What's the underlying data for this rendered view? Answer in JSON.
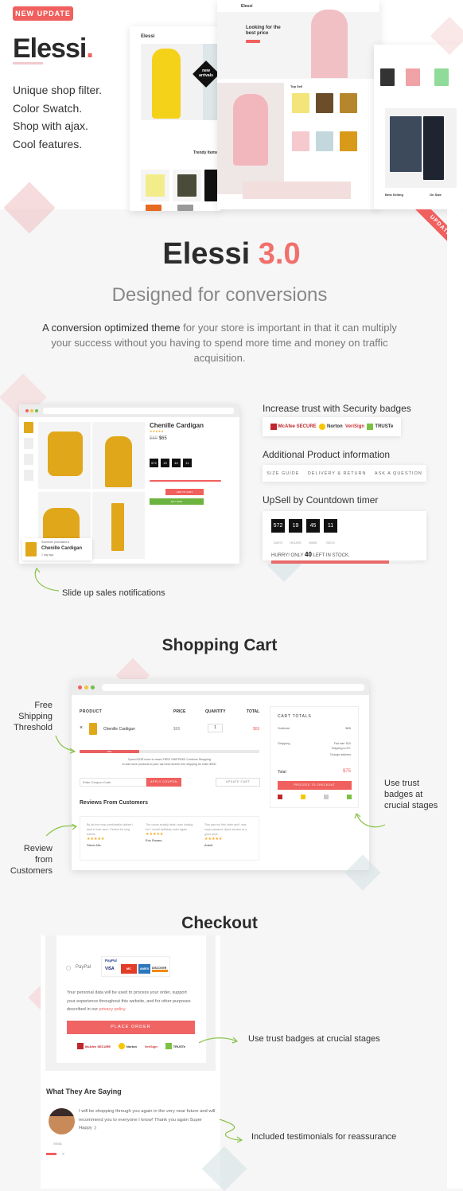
{
  "hero": {
    "badge": "NEW UPDATE",
    "logo": "Elessi",
    "logo_dot": ".",
    "features": [
      "Unique shop filter.",
      "Color Swatch.",
      "Shop with ajax.",
      "Cool features."
    ],
    "corner_ribbon": "UPDATE",
    "mock_texts": {
      "brand": "Elessi",
      "new_arrivals": "new arrivals",
      "trendy": "Trendy Items",
      "looking": "Looking for the best price",
      "top_sell": "Top Sell",
      "best_selling": "Best Selling",
      "on_sale": "On Sale"
    }
  },
  "intro": {
    "title": "Elessi",
    "version": "3.0",
    "subtitle": "Designed for conversions",
    "lead": "A conversion optimized theme",
    "body1": " for your store is important in that it can multiply your success without you having to spend more time and money on traffic acquisition."
  },
  "product": {
    "name": "Chenille Cardigan",
    "old_price": "$80",
    "price": "$65",
    "countdown": [
      "572",
      "19",
      "45",
      "11"
    ],
    "add_to_cart": "ADD TO CART",
    "buy_now": "BUY NOW",
    "notification": {
      "line": "Someone purchased a",
      "product": "Chenille Cardigan",
      "time": "1 day ago"
    }
  },
  "features": {
    "security": "Increase trust with Security badges",
    "badges": [
      "McAfee SECURE",
      "Norton",
      "VeriSign",
      "TRUSTe"
    ],
    "additional": "Additional Product information",
    "tabs": [
      "SIZE GUIDE",
      "DELIVERY & RETURN",
      "ASK A QUESTION"
    ],
    "upsell": "UpSell by Countdown timer",
    "countdown": [
      {
        "v": "572",
        "l": "DAYS"
      },
      {
        "v": "19",
        "l": "HOURS"
      },
      {
        "v": "45",
        "l": "MINS"
      },
      {
        "v": "11",
        "l": "SECS"
      }
    ],
    "hurry_pre": "HURRY! ONLY ",
    "hurry_num": "40",
    "hurry_post": " LEFT IN STOCK.",
    "stock_progress": 0.82,
    "slide_up": "Slide up sales notifications"
  },
  "cart": {
    "title": "Shopping Cart",
    "headers": [
      "PRODUCT",
      "PRICE",
      "QUANTITY",
      "TOTAL"
    ],
    "row": {
      "remove": "×",
      "name": "Chenille Cardigan",
      "price": "$65",
      "qty": "1",
      "total": "$65"
    },
    "threshold_label": "75%",
    "threshold_progress": 0.33,
    "threshold_text1": "Spend $135 more to reach FREE SHIPPING! Continue Shopping",
    "threshold_text2": "to add more products to your cart and receive free shipping for order $200.",
    "coupon_placeholder": "Enter Coupon Code",
    "apply": "APPLY COUPON",
    "update": "UPDATE CART",
    "reviews_title": "Reviews From Customers",
    "reviews": [
      {
        "text": "By far the most comfortable clothes I deal in ever seen. Perfect for long travels.",
        "name": "Steve Alis."
      },
      {
        "text": "The colors exactly what I was looking for! I would definitely order again.",
        "name": "Eric Rowen."
      },
      {
        "text": "This was my first order and I was super pleased. Quick service at a good price.",
        "name": "Ardell."
      }
    ],
    "stars": "★★★★★",
    "totals": {
      "title": "CART TOTALS",
      "subtotal_l": "Subtotal",
      "subtotal": "$65",
      "shipping_l": "Shipping",
      "shipping1": "Flat rate: $10",
      "shipping2": "Shipping to NY.",
      "shipping3": "Change address",
      "total_l": "Total",
      "total": "$75",
      "checkout": "PROCEED TO CHECKOUT"
    },
    "callouts": {
      "free": "Free Shipping Threshold",
      "review": "Review from Customers",
      "trust": "Use trust badges at crucial stages"
    }
  },
  "checkout": {
    "title": "Checkout",
    "paypal": "PayPal",
    "paypal_logo": "PayPal",
    "cards": [
      "VISA",
      "MC",
      "AMEX",
      "DISCOVER"
    ],
    "privacy": "Your personal data will be used to process your order, support your experience throughout this website, and for other purposes described in our ",
    "privacy_link": "privacy policy.",
    "place_order": "PLACE ORDER",
    "testimonials_title": "What They Are Saying",
    "testimonial": "I will be shopping through you again in the very near future and will recommend you to everyone I know! Thank you again Super Happy :)",
    "author": "Anna",
    "callout_trust": "Use trust badges at crucial stages",
    "callout_testimonials": "Included testimonials for reassurance"
  },
  "colors": {
    "accent": "#f0605e",
    "green": "#8bc34a",
    "dark": "#2c2c2c"
  }
}
